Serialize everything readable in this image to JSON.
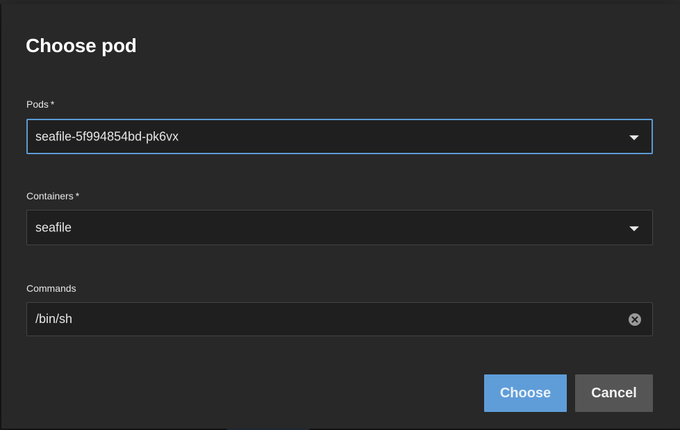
{
  "dialog": {
    "title": "Choose pod",
    "pods": {
      "label": "Pods",
      "required_mark": "*",
      "value": "seafile-5f994854bd-pk6vx"
    },
    "containers": {
      "label": "Containers",
      "required_mark": "*",
      "value": "seafile"
    },
    "commands": {
      "label": "Commands",
      "value": "/bin/sh"
    },
    "buttons": {
      "choose": "Choose",
      "cancel": "Cancel"
    }
  },
  "colors": {
    "dialog_background": "#282828",
    "focus_accent": "#5b9bd5",
    "primary_button": "#5f9dd9",
    "secondary_button": "#555555"
  },
  "icons": {
    "select_caret": "chevron-down-icon",
    "clear": "clear-circle-icon"
  }
}
